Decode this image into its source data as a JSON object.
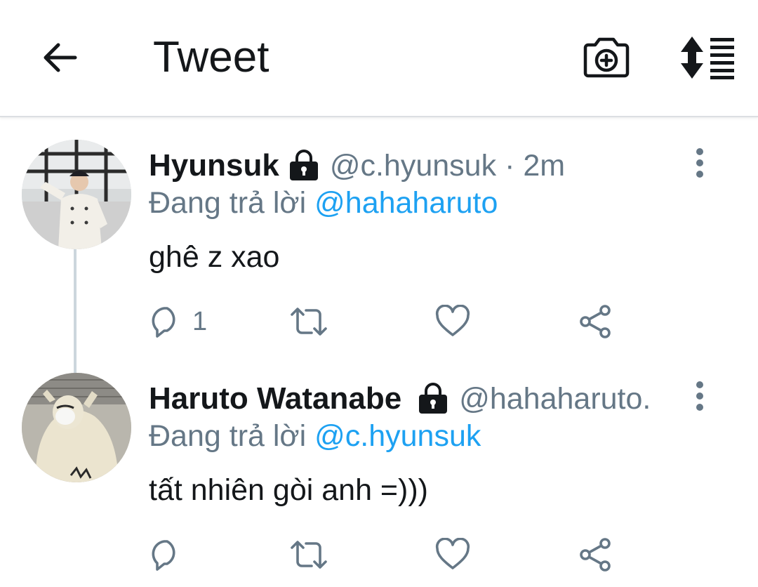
{
  "header": {
    "title": "Tweet",
    "back_icon": "arrow-left-icon",
    "camera_icon": "camera-plus-icon",
    "sort_icon": "sort-thread-icon"
  },
  "tweets": [
    {
      "name": "Hyunsuk",
      "protected": true,
      "handle": "@c.hyunsuk",
      "time": "· 2m",
      "reply_prefix": "Đang trả lời ",
      "reply_to": "@hahaharuto",
      "text": "ghê z xao",
      "reply_count": "1",
      "avatar": "person-photo-white-jacket"
    },
    {
      "name": "Haruto Watanabe",
      "protected": true,
      "handle": "@hahaharuto.",
      "time": "",
      "reply_prefix": "Đang trả lời ",
      "reply_to": "@c.hyunsuk",
      "text": "tất nhiên gòi anh =)))",
      "reply_count": "",
      "avatar": "person-photo-hoodie-mask"
    }
  ],
  "colors": {
    "accent": "#1da1f2",
    "secondary_text": "#657786",
    "primary_text": "#14171a",
    "thread_line": "#ccd6dd"
  }
}
